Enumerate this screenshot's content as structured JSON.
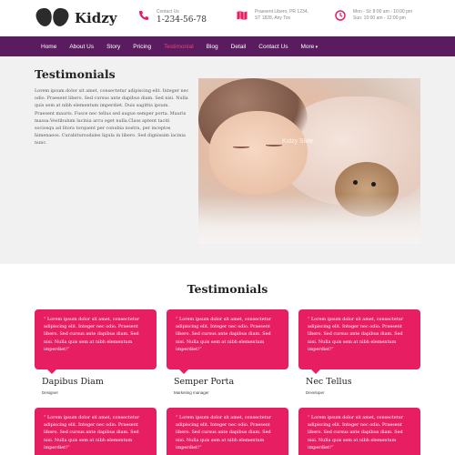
{
  "brand": {
    "name": "Kidzy"
  },
  "header": {
    "contact": {
      "label": "Contact Us",
      "phone": "1-234-56-78"
    },
    "address": {
      "line1": "Praesent Libero, PR 1234,",
      "line2": "ST 1828, Any Tos"
    },
    "hours": {
      "line1": "Mon - St: 8:00 am - 10:00 pm",
      "line2": "Sun: 10:00 am - 12:00 pm"
    }
  },
  "nav": {
    "items": [
      "Home",
      "About Us",
      "Story",
      "Pricing",
      "Testimonial",
      "Blog",
      "Detail",
      "Contact Us",
      "More"
    ],
    "active_index": 4
  },
  "hero": {
    "title": "Testimonials",
    "text": "Lorem ipsum dolor sit amet, consectetur adipiscing elit. Integer nec odio. Praesent libero. Sed cursus ante dapibus diam. Sed nisi. Nulla quis sem at nibh elementum imperdiet. Duis sagittis ipsum. Praesent mauris. Fusce nec tellus sed augue semper porta. Mauris massa.Vestibulum lacinia arcu eget nulla.Class aptent taciti sociosqu ad litora torquent per conubia nostra, per inceptos himenaeos. Curabitursodales ligula in libero. Sed dignissim lacinia nunc.",
    "image_caption": "Kidzy Slide"
  },
  "testimonials": {
    "title": "Testimonials",
    "quote": "“ Lorem ipsum dolor sit amet, consectetur adipiscing elit. Integer nec odio. Praesent libero. Sed cursus ante dapibus diam. Sed nisi. Nulla quis sem at nibh elementum imperdiet!”",
    "people": [
      {
        "name": "Dapibus Diam",
        "role": "Designer"
      },
      {
        "name": "Semper Porta",
        "role": "Marketing manager"
      },
      {
        "name": "Nec Tellus",
        "role": "Developer"
      }
    ]
  },
  "colors": {
    "nav_bg": "#5b1c5f",
    "accent": "#e81e63",
    "active_nav": "#e9407d"
  },
  "icons": {
    "phone": "phone-icon",
    "map": "map-icon",
    "clock": "clock-icon"
  }
}
